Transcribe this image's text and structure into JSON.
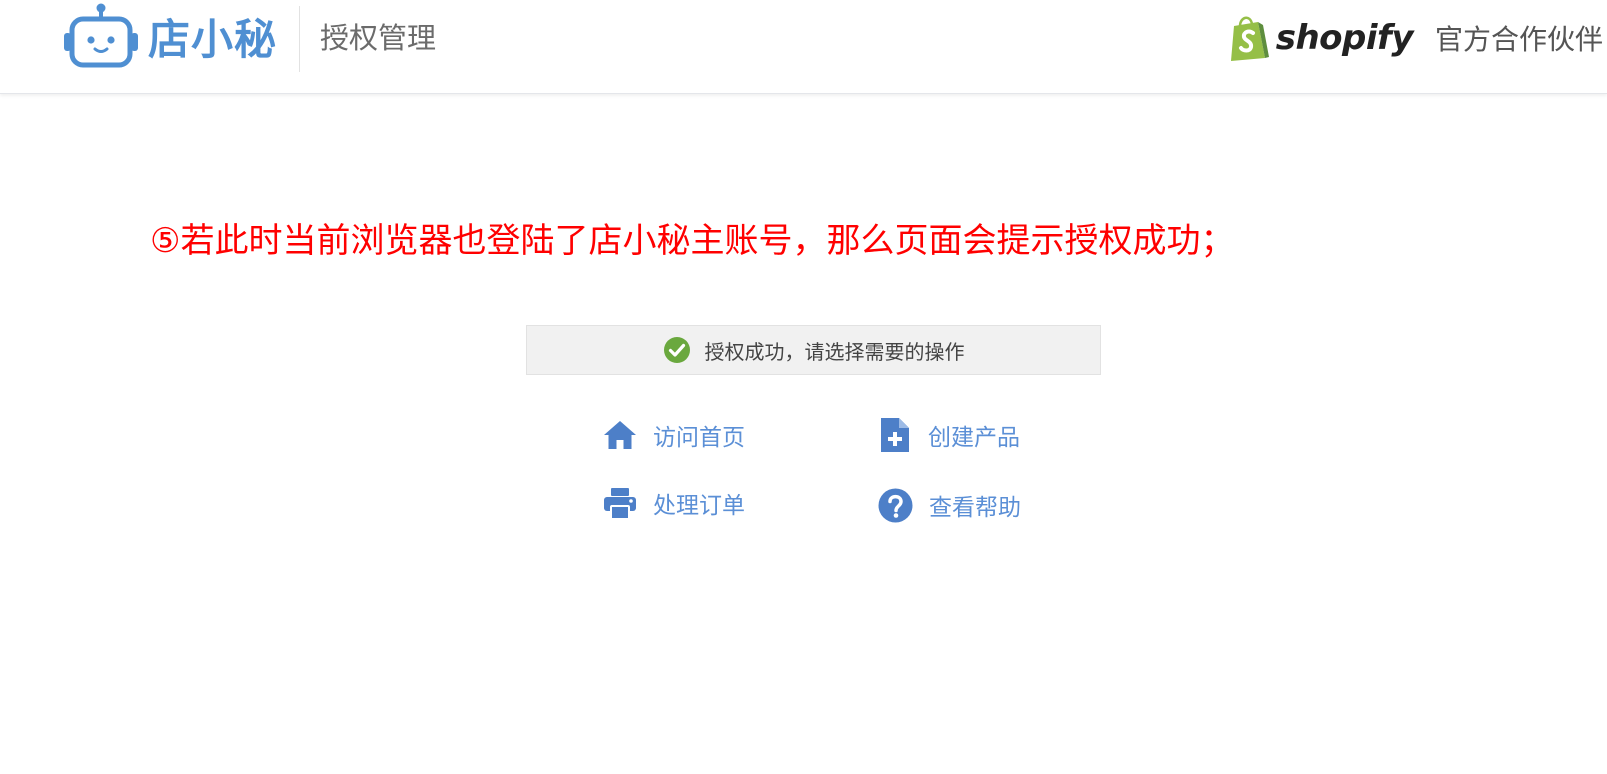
{
  "header": {
    "brand_name": "店小秘",
    "title": "授权管理",
    "partner_brand": "shopify",
    "partner_label": "官方合作伙伴"
  },
  "instruction": "⑤若此时当前浏览器也登陆了店小秘主账号，那么页面会提示授权成功；",
  "success": {
    "message": "授权成功，请选择需要的操作"
  },
  "actions": [
    {
      "label": "访问首页",
      "icon": "home-icon"
    },
    {
      "label": "创建产品",
      "icon": "file-plus-icon"
    },
    {
      "label": "处理订单",
      "icon": "printer-icon"
    },
    {
      "label": "查看帮助",
      "icon": "question-circle-icon"
    }
  ],
  "colors": {
    "brand_blue": "#4f8fd2",
    "link_blue": "#5b8fd6",
    "instruction_red": "#ff0000",
    "success_green": "#6aa83e",
    "shopify_green": "#95bf47"
  }
}
